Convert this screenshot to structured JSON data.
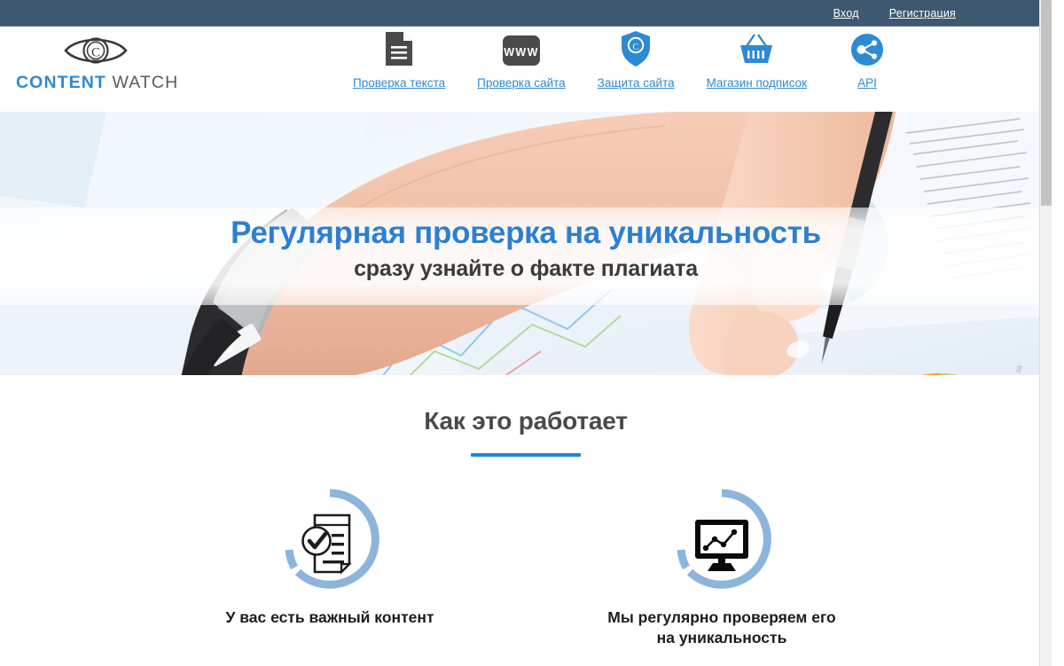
{
  "topbar": {
    "login_label": "Вход",
    "register_label": "Регистрация"
  },
  "brand": {
    "name_first": "CONTENT",
    "name_second": " WATCH",
    "logo_icon": "eye-copyright-icon",
    "accent_color": "#2d8ad4",
    "secondary_color": "#58595b"
  },
  "nav": {
    "items": [
      {
        "label": "Проверка текста",
        "icon": "document-lines-icon"
      },
      {
        "label": "Проверка сайта",
        "icon": "www-box-icon"
      },
      {
        "label": "Защита сайта",
        "icon": "shield-copyright-icon"
      },
      {
        "label": "Магазин подписок",
        "icon": "shopping-basket-icon"
      },
      {
        "label": "API",
        "icon": "api-nodes-icon"
      }
    ]
  },
  "hero": {
    "title": "Регулярная проверка на уникальность",
    "subtitle": "сразу узнайте о факте плагиата",
    "title_color": "#2d7fd1",
    "subtitle_color": "#3b3b3b",
    "background_description": "hand-with-watch-and-hand-holding-pen-over-charts-photo"
  },
  "how_it_works": {
    "heading": "Как это работает",
    "rule_color": "#1887e0",
    "steps": [
      {
        "label": "У вас есть важный контент",
        "icon": "document-check-icon",
        "ring_color": "#8cb4dc"
      },
      {
        "label": "Мы регулярно проверяем его\nна уникальность",
        "icon": "monitor-chart-icon",
        "ring_color": "#8cb4dc"
      }
    ]
  },
  "scrollbar": {
    "thumb_position": "top",
    "track_color": "#f1f1f1",
    "thumb_color": "#c2c2c2"
  }
}
